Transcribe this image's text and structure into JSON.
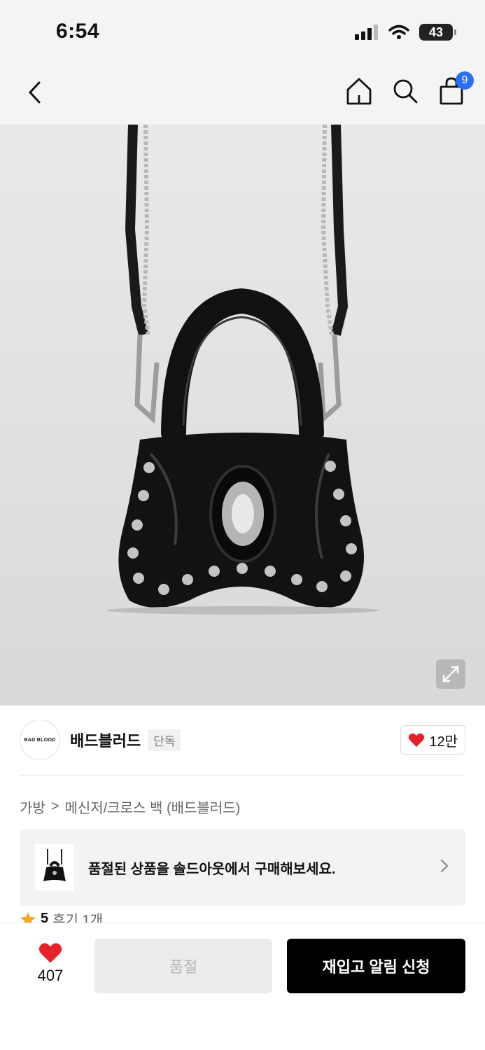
{
  "status_bar": {
    "time": "6:54",
    "battery": "43"
  },
  "nav": {
    "cart_count": "9"
  },
  "product": {
    "image_icon": "crossbody-bag-image"
  },
  "brand": {
    "logo_text": "BAD BLOOD",
    "name": "배드블러드",
    "tag": "단독",
    "like_count": "12만",
    "like_color": "#e8202a"
  },
  "breadcrumb": {
    "category": "가방",
    "separator": ">",
    "subcategory": "메신저/크로스 백 (배드블러드)"
  },
  "soldout_banner": {
    "text": "품절된 상품을 솔드아웃에서 구매해보세요."
  },
  "review": {
    "score": "5",
    "count_text": "후기 1개"
  },
  "bottom_bar": {
    "wish_count": "407",
    "soldout_label": "품절",
    "restock_label": "재입고 알림 신청"
  }
}
